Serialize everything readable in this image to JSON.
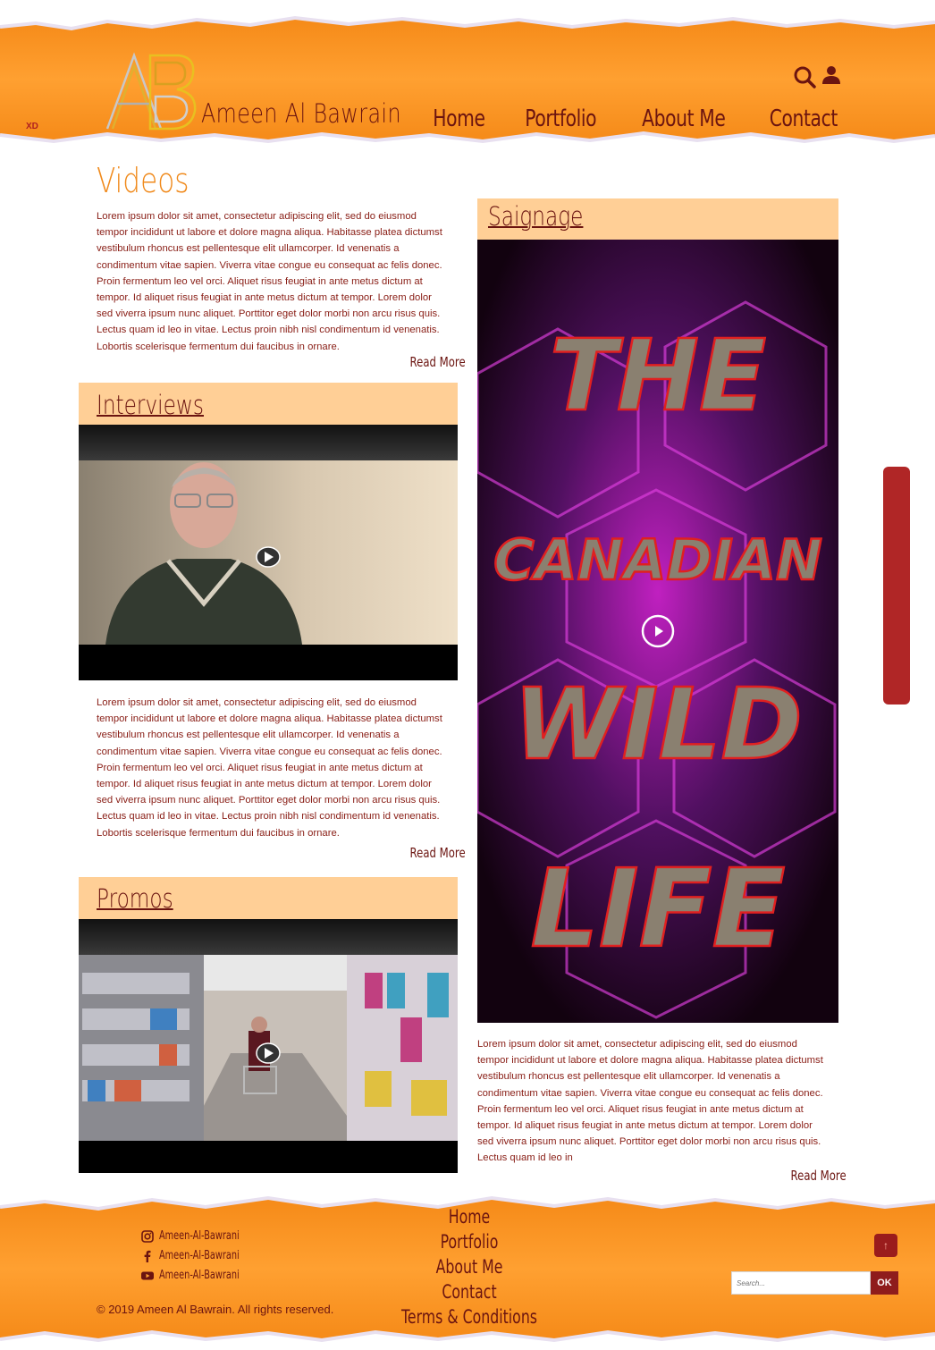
{
  "header": {
    "badge": "XD",
    "brand_name": "Ameen Al Bawrain",
    "logo_letters": "AB",
    "nav": [
      "Home",
      "Portfolio",
      "About Me",
      "Contact"
    ]
  },
  "main": {
    "videos_title": "Videos",
    "lorem": "Lorem ipsum dolor sit amet, consectetur adipiscing elit, sed do eiusmod tempor incididunt ut labore et dolore magna aliqua. Habitasse platea dictumst vestibulum rhoncus est pellentesque elit ullamcorper. Id venenatis a condimentum vitae sapien. Viverra vitae congue eu consequat ac felis donec. Proin fermentum leo vel orci. Aliquet risus feugiat in ante metus dictum at tempor. Id aliquet risus feugiat in ante metus dictum at tempor. Lorem dolor sed viverra ipsum nunc aliquet. Porttitor eget dolor morbi non arcu risus quis. Lectus quam id leo in vitae. Lectus proin nibh nisl condimentum id venenatis. Lobortis scelerisque fermentum dui faucibus in ornare.",
    "lorem_short": "Lorem ipsum dolor sit amet, consectetur adipiscing elit, sed do eiusmod tempor incididunt ut labore et dolore magna aliqua. Habitasse platea dictumst vestibulum rhoncus est pellentesque elit ullamcorper. Id venenatis a condimentum vitae sapien. Viverra vitae congue eu consequat ac felis donec. Proin fermentum leo vel orci. Aliquet risus feugiat in ante metus dictum at tempor. Id aliquet risus feugiat in ante metus dictum at tempor. Lorem dolor sed viverra ipsum nunc aliquet. Porttitor eget dolor morbi non arcu risus quis. Lectus quam id leo in",
    "read_more": "Read More",
    "sections": {
      "interviews": "Interviews",
      "promos": "Promos",
      "signage": "Saignage"
    },
    "poster_text": [
      "THE",
      "CANADIAN",
      "WILD",
      "LIFE"
    ]
  },
  "footer": {
    "social": [
      {
        "icon": "instagram-icon",
        "label": "Ameen-Al-Bawrani"
      },
      {
        "icon": "facebook-icon",
        "label": "Ameen-Al-Bawrani"
      },
      {
        "icon": "youtube-icon",
        "label": "Ameen-Al-Bawrani"
      }
    ],
    "copyright": "© 2019 Ameen Al Bawrain. All rights reserved.",
    "nav": [
      "Home",
      "Portfolio",
      "About Me",
      "Contact",
      "Terms & Conditions"
    ],
    "search_placeholder": "Search...",
    "search_button": "OK",
    "back_to_top": "↑"
  },
  "colors": {
    "orange": "#f7941d",
    "peach": "#ffcf96",
    "maroon": "#6b1410",
    "accent_red": "#b02626"
  }
}
